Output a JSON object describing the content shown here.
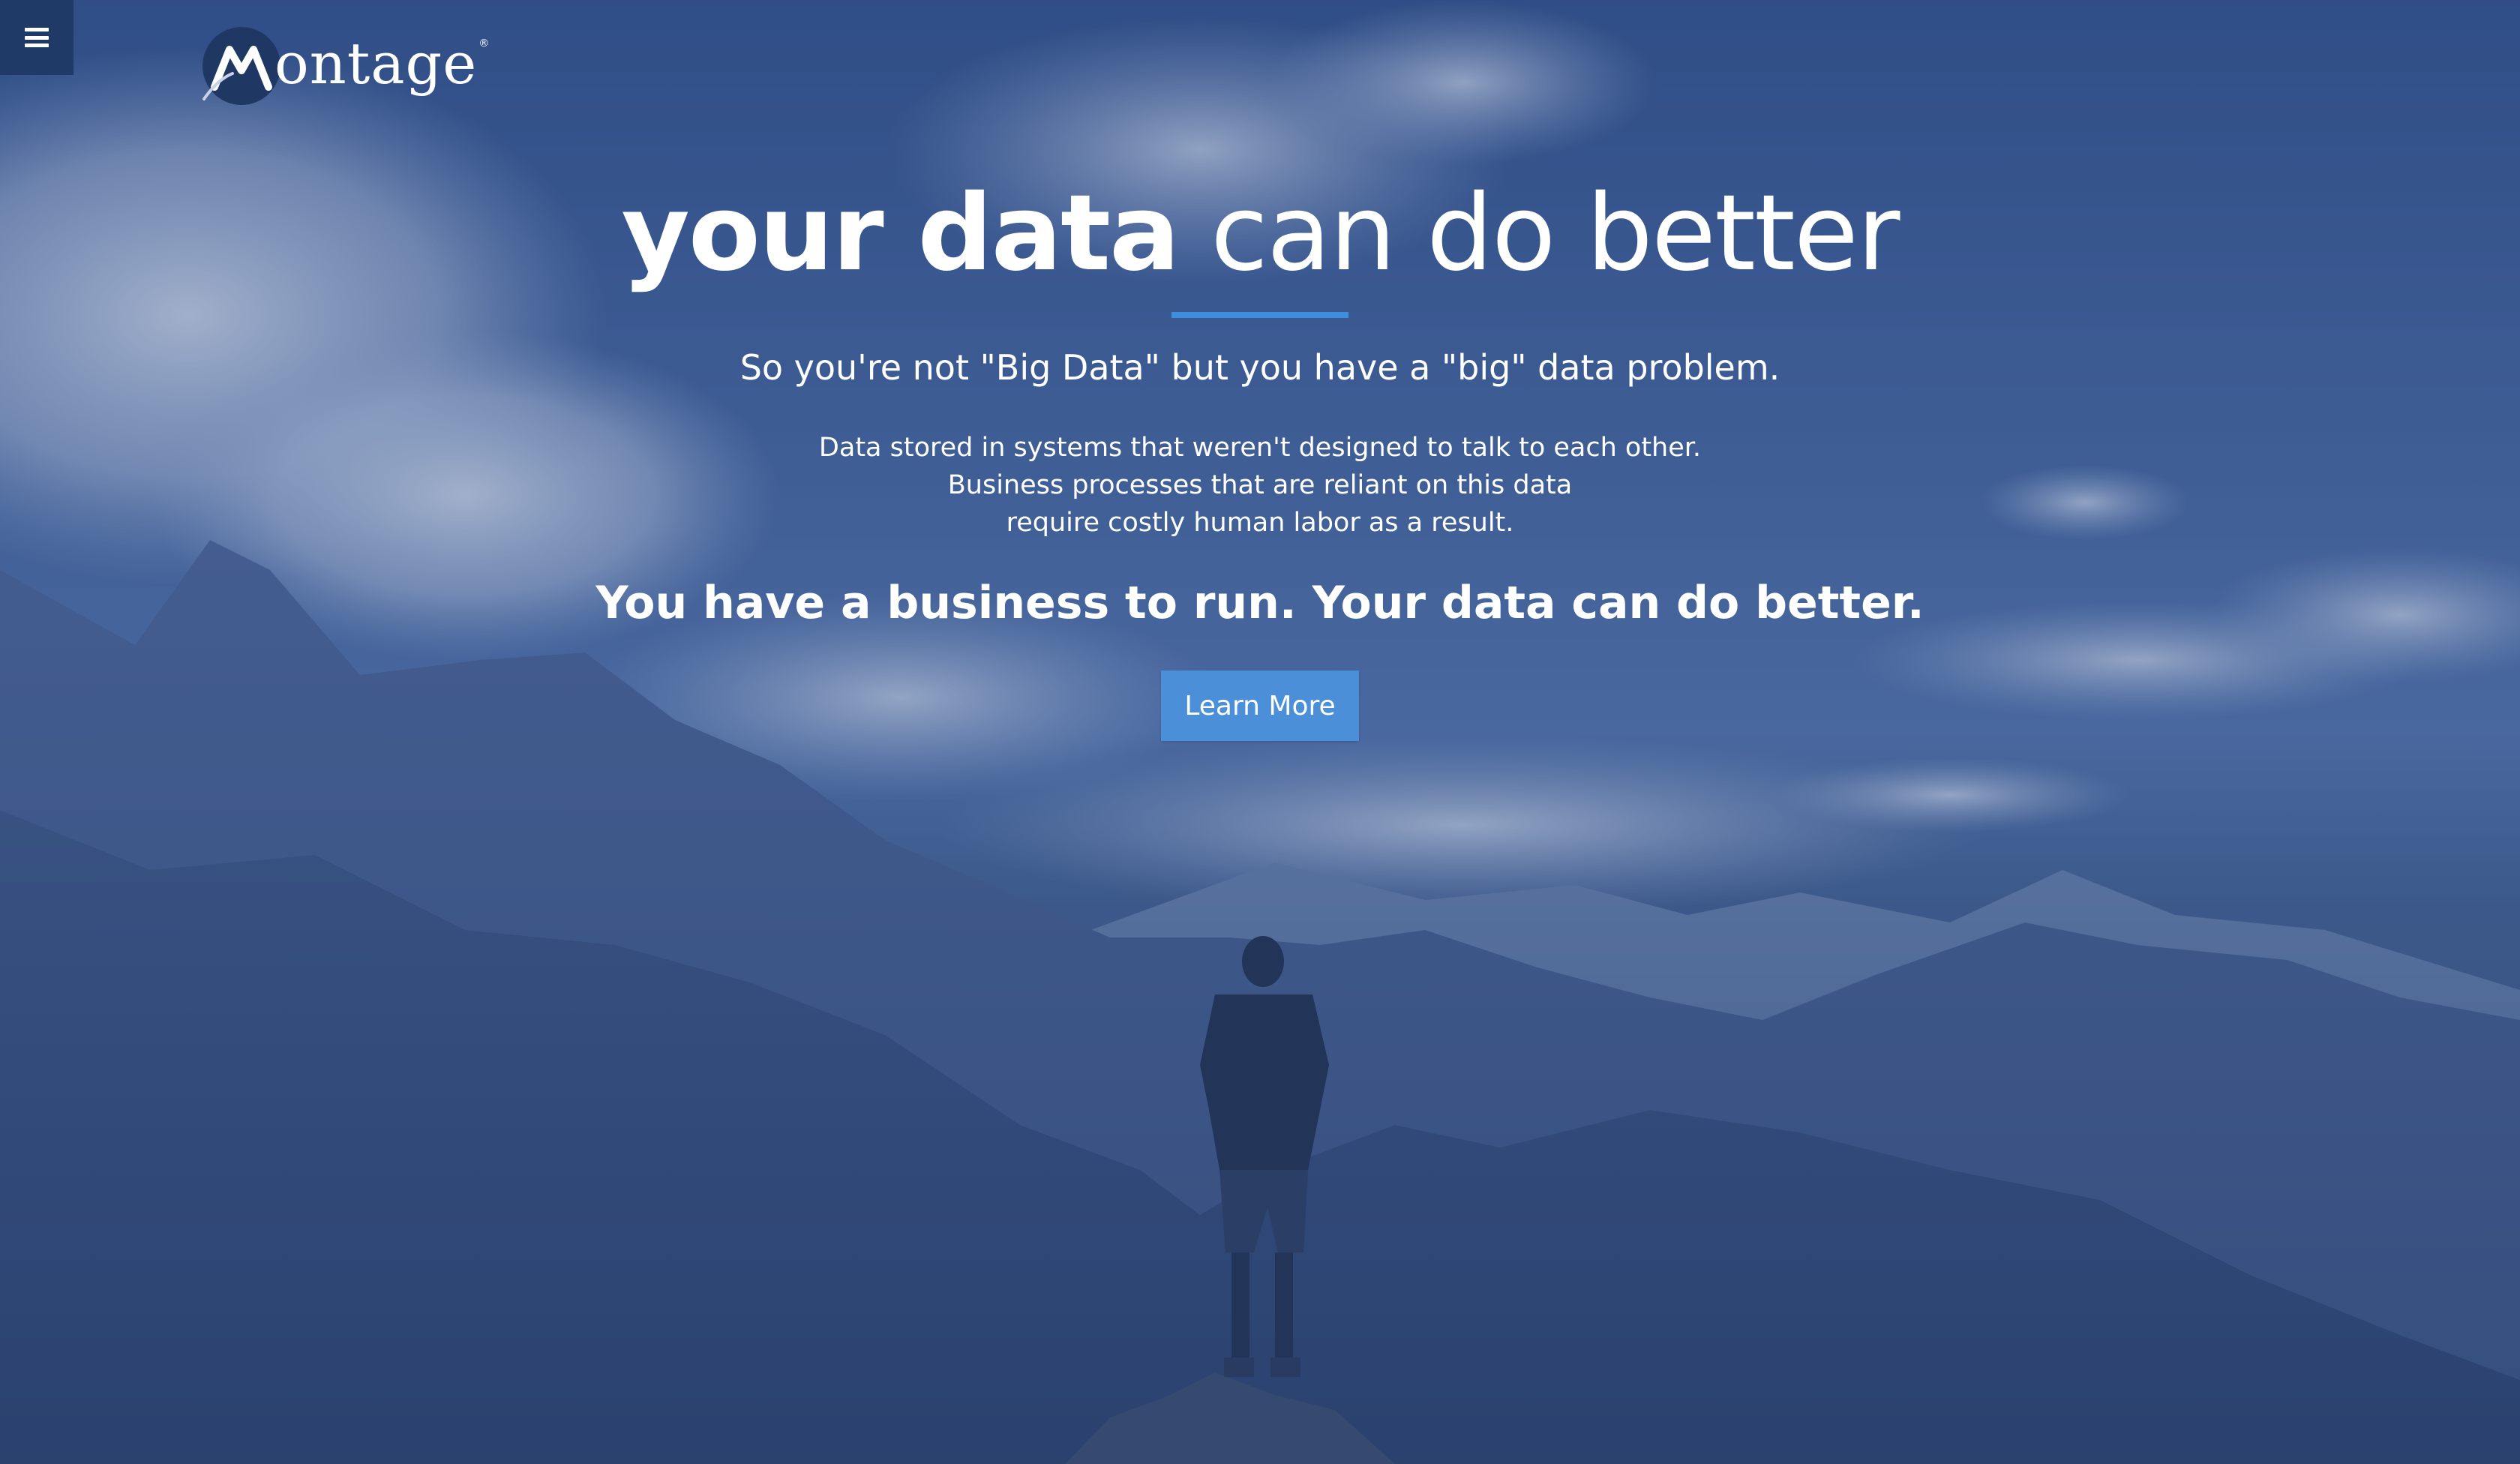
{
  "colors": {
    "overlay": "#2c4882",
    "menu_button_bg": "#1f3a66",
    "accent": "#3d8fdc",
    "cta_bg": "#4a8fd8",
    "text": "#ffffff"
  },
  "nav": {
    "menu_icon": "hamburger-menu-icon"
  },
  "logo": {
    "text": "ontage",
    "mark_letter": "M",
    "tm": "®"
  },
  "hero": {
    "headline_bold": "your data",
    "headline_light": "can do better",
    "subheadline": "So you're not \"Big Data\" but you have a \"big\" data problem.",
    "body_lines": [
      "Data stored in systems that weren't designed to talk to each other.",
      "Business processes that are reliant on this data",
      "require costly human labor as a result."
    ],
    "tagline": "You have a business to run. Your data can do better.",
    "cta_label": "Learn More"
  }
}
